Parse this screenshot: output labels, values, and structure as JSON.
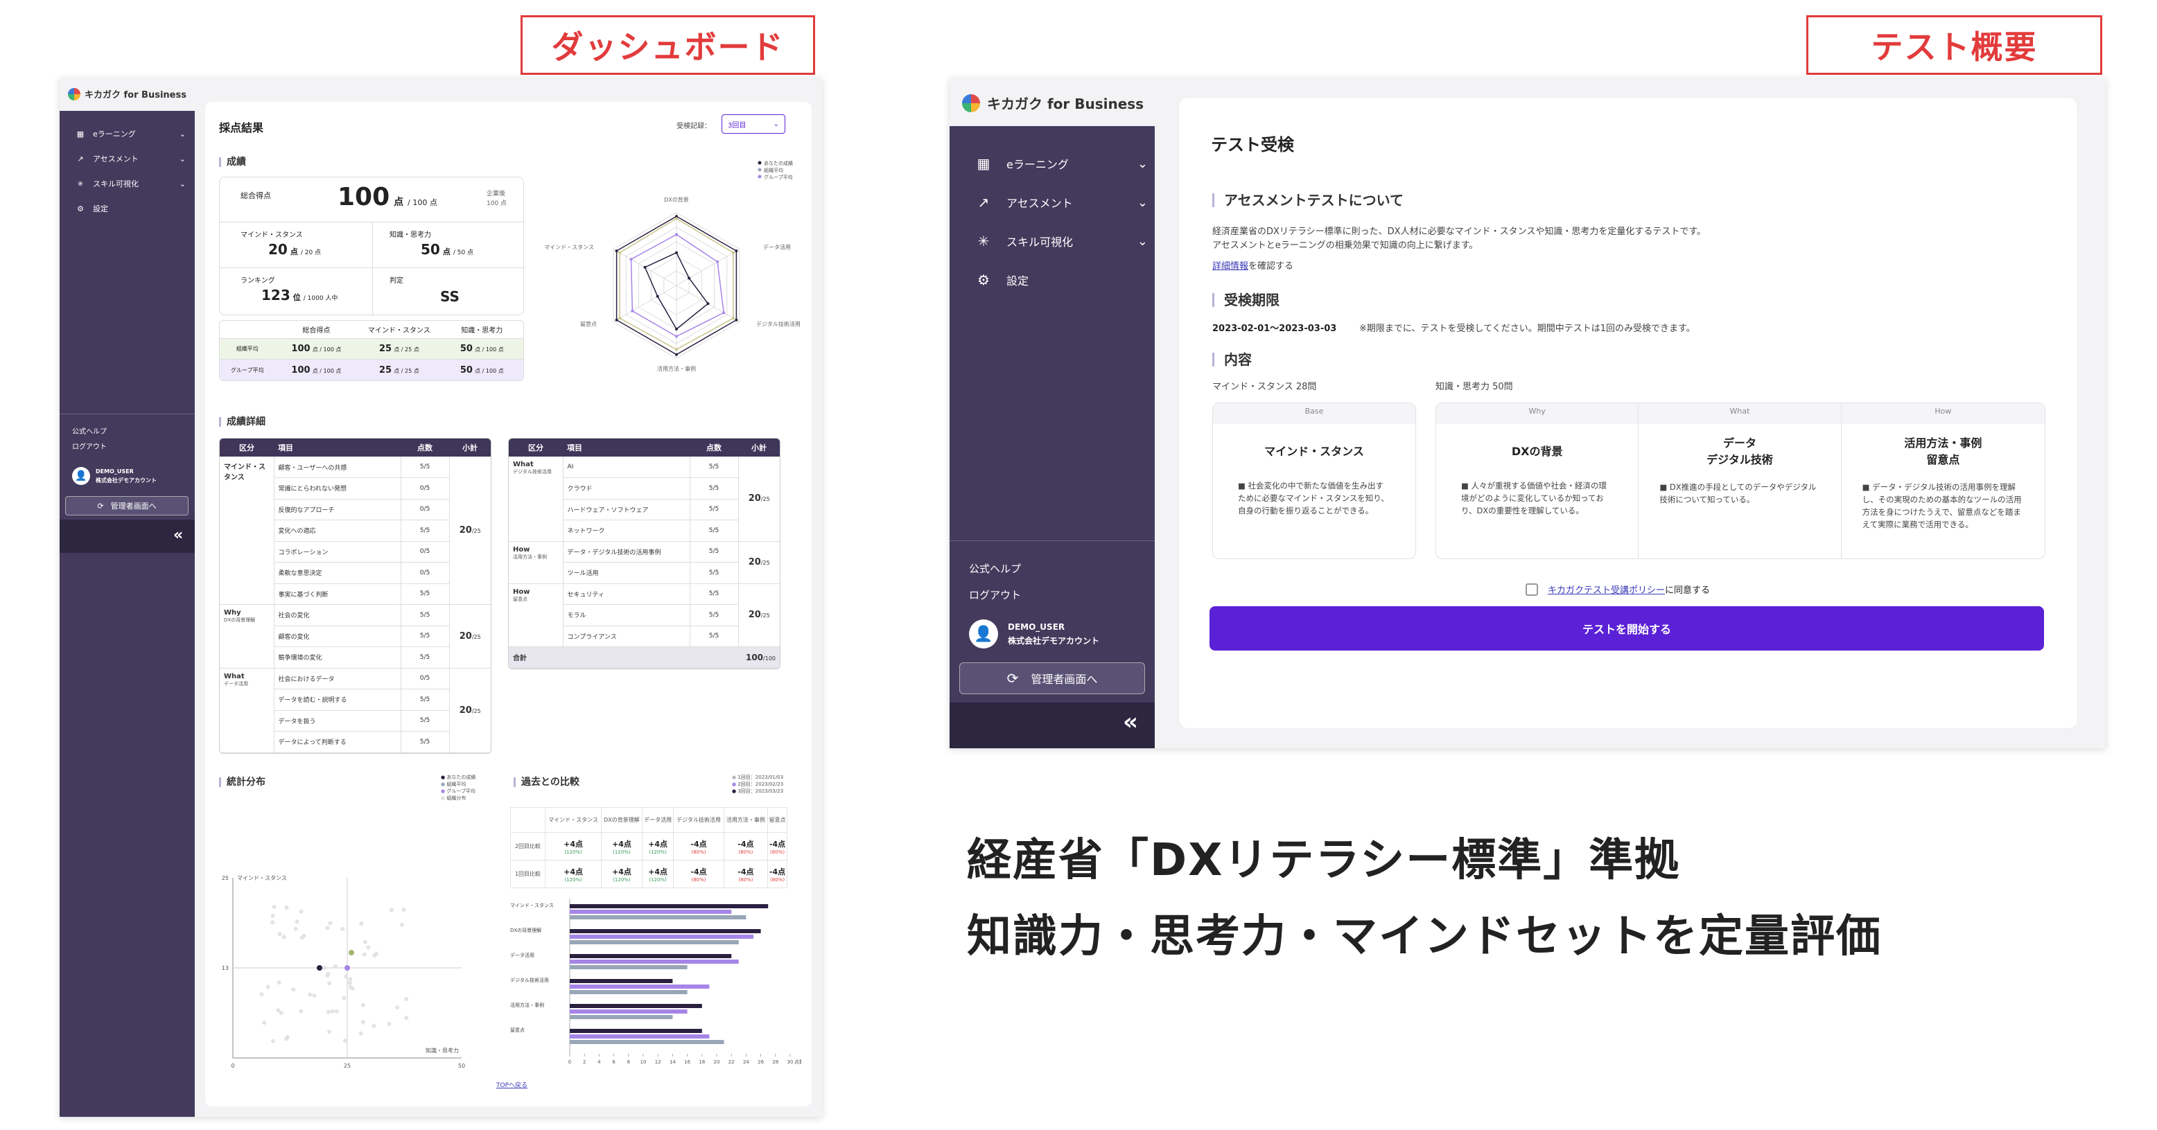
{
  "labels": {
    "dashboard": "ダッシュボード",
    "test_overview": "テスト概要"
  },
  "brand": {
    "name": "キカガク for Business"
  },
  "sidebar": {
    "items": [
      {
        "label": "eラーニング",
        "icon": "grid-icon"
      },
      {
        "label": "アセスメント",
        "icon": "chart-line-icon"
      },
      {
        "label": "スキル可視化",
        "icon": "sparkle-icon"
      },
      {
        "label": "設定",
        "icon": "gear-icon"
      }
    ],
    "help": "公式ヘルプ",
    "logout": "ログアウト",
    "user": "DEMO_USER",
    "company": "株式会社デモアカウント",
    "admin_button": "管理者画面へ",
    "collapse": "«"
  },
  "dashboard": {
    "title": "採点結果",
    "select_label": "受検記録：",
    "select_value": "3回目",
    "sec_score": "成績",
    "total_label": "総合得点",
    "total_value": "100",
    "total_unit": "点",
    "total_max": "/ 100 点",
    "avg_note1": "企業後",
    "avg_note2": "100 点",
    "mind_label": "マインド・スタンス",
    "mind_value": "20",
    "mind_unit": "点",
    "mind_max": "/ 20 点",
    "know_label": "知識・思考力",
    "know_value": "50",
    "know_unit": "点",
    "know_max": "/ 50 点",
    "rank_label": "ランキング",
    "rank_value": "123",
    "rank_unit": "位",
    "rank_max": "/ 1000 人中",
    "judge_label": "判定",
    "judge_value": "SS",
    "legend": [
      "あなたの成績",
      "組織平均",
      "グループ平均"
    ],
    "radar_labels": [
      "DXの背景",
      "データ活用",
      "デジタル技術活用",
      "活用方法・事例",
      "留意点",
      "マインド・スタンス"
    ],
    "summary": {
      "headers": [
        "総合得点",
        "マインド・スタンス",
        "知識・思考力"
      ],
      "rows": [
        {
          "label": "組織平均",
          "total": "100",
          "mind": "25",
          "know": "50"
        },
        {
          "label": "グループ平均",
          "total": "100",
          "mind": "25",
          "know": "50"
        }
      ],
      "total_unit": "点 / 100 点",
      "mind_unit": "点 / 25 点",
      "know_unit": "点 / 100 点"
    },
    "sec_detail": "成績詳細",
    "table_headers": [
      "区分",
      "項目",
      "点数",
      "小計"
    ],
    "left_table": [
      {
        "cat": "マインド・スタンス",
        "sub": "",
        "subtotal": "20",
        "items": [
          "顧客・ユーザーへの共感",
          "常識にとらわれない発想",
          "反復的なアプローチ",
          "変化への適応",
          "コラボレーション",
          "柔軟な意思決定",
          "事実に基づく判断"
        ]
      },
      {
        "cat": "Why",
        "sub": "DXの背景理解",
        "subtotal": "20",
        "items": [
          "社会の変化",
          "顧客の変化",
          "競争環境の変化"
        ]
      },
      {
        "cat": "What",
        "sub": "データ活用",
        "subtotal": "20",
        "items": [
          "社会におけるデータ",
          "データを読む・説明する",
          "データを扱う",
          "データによって判断する"
        ]
      }
    ],
    "right_table": [
      {
        "cat": "What",
        "sub": "デジタル技術活用",
        "subtotal": "20",
        "items": [
          "AI",
          "クラウド",
          "ハードウェア・ソフトウェア",
          "ネットワーク"
        ]
      },
      {
        "cat": "How",
        "sub": "活用方法・事例",
        "subtotal": "20",
        "items": [
          "データ・デジタル技術の活用事例",
          "ツール活用"
        ]
      },
      {
        "cat": "How",
        "sub": "留意点",
        "subtotal": "20",
        "items": [
          "セキュリティ",
          "モラル",
          "コンプライアンス"
        ]
      }
    ],
    "score_item": "5/5",
    "score_zero": "0/5",
    "subtotal_unit": "/25",
    "total_row_label": "合計",
    "total_row_value": "100",
    "total_row_unit": "/100",
    "sec_stats": "統計分布",
    "stats_legend": [
      "あなたの成績",
      "組織平均",
      "グループ平均",
      "組織分布"
    ],
    "scatter_ylabel": "マインド・スタンス",
    "scatter_xlabel": "知識・思考力",
    "scatter_xticks": [
      "0",
      "25",
      "50"
    ],
    "scatter_yticks": [
      "25",
      "13"
    ],
    "sec_past": "過去との比較",
    "past_legend": [
      "1回目：2023/01/03",
      "2回目：2023/02/23",
      "3回目：2023/03/23"
    ],
    "compare": {
      "headers": [
        "マインド・スタンス",
        "DXの背景理解",
        "データ活用",
        "デジタル技術活用",
        "活用方法・事例",
        "留意点"
      ],
      "rows": [
        {
          "label": "2回目比較",
          "vals": [
            "+4点",
            "+4点",
            "+4点",
            "-4点",
            "-4点",
            "-4点"
          ],
          "pct": [
            "(120%)",
            "(120%)",
            "(120%)",
            "(80%)",
            "(80%)",
            "(80%)"
          ]
        },
        {
          "label": "1回目比較",
          "vals": [
            "+4点",
            "+4点",
            "+4点",
            "-4点",
            "-4点",
            "-4点"
          ],
          "pct": [
            "(120%)",
            "(120%)",
            "(120%)",
            "(80%)",
            "(80%)",
            "(80%)"
          ]
        }
      ]
    },
    "hbar": {
      "categories": [
        "マインド・スタンス",
        "DXの背景理解",
        "データ活用",
        "デジタル技術活用",
        "活用方法・事例",
        "留意点"
      ],
      "xticks": [
        "0",
        "2",
        "4",
        "6",
        "8",
        "10",
        "12",
        "14",
        "16",
        "18",
        "20",
        "22",
        "24",
        "26",
        "28",
        "30"
      ],
      "xunit": "点数"
    },
    "top_link": "TOPへ戻る"
  },
  "test": {
    "title": "テスト受検",
    "about_heading": "アセスメントテストについて",
    "about_text1": "経済産業省のDXリテラシー標準に則った、DX人材に必要なマインド・スタンスや知識・思考力を定量化するテストです。",
    "about_text2": "アセスメントとeラーニングの相乗効果で知識の向上に繋げます。",
    "detail_link": "詳細情報",
    "detail_suffix": "を確認する",
    "period_heading": "受検期限",
    "period_dates": "2023-02-01〜2023-03-03",
    "period_note": "※期限までに、テストを受検してください。期間中テストは1回のみ受検できます。",
    "content_heading": "内容",
    "mind_count": "マインド・スタンス 28問",
    "know_count": "知識・思考力 50問",
    "cards": [
      {
        "tag": "Base",
        "title": "マインド・スタンス",
        "desc": "■ 社会変化の中で新たな価値を生み出すために必要なマインド・スタンスを知り、自身の行動を振り返ることができる。"
      },
      {
        "tag": "Why",
        "title": "DXの背景",
        "desc": "■ 人々が重視する価値や社会・経済の環境がどのように変化しているか知っており、DXの重要性を理解している。"
      },
      {
        "tag": "What",
        "title": "データ\nデジタル技術",
        "desc": "■ DX推進の手段としてのデータやデジタル技術について知っている。"
      },
      {
        "tag": "How",
        "title": "活用方法・事例\n留意点",
        "desc": "■ データ・デジタル技術の活用事例を理解し、その実現のための基本的なツールの活用方法を身につけたうえで、留意点などを踏まえて実際に業務で活用できる。"
      }
    ],
    "agree_link": "キカガクテスト受講ポリシー",
    "agree_suffix": "に同意する",
    "start_button": "テストを開始する"
  },
  "headline": {
    "line1": "経産省「DXリテラシー標準」準拠",
    "line2": "知識力・思考力・マインドセットを定量評価"
  },
  "colors": {
    "sidebar": "#433a5c",
    "accent": "#5b21d6",
    "red": "#e23b3b",
    "header": "#3f365a"
  }
}
